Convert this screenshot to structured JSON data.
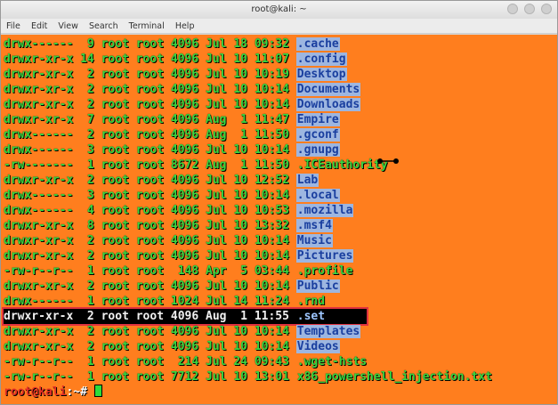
{
  "window": {
    "title": "root@kali: ~"
  },
  "menubar": {
    "items": [
      "File",
      "Edit",
      "View",
      "Search",
      "Terminal",
      "Help"
    ]
  },
  "listing": [
    {
      "perms": "drwx------",
      "links": "9",
      "owner": "root",
      "group": "root",
      "size": "4096",
      "month": "Jul",
      "day": "18",
      "time": "09:32",
      "name": ".cache",
      "kind": "dir"
    },
    {
      "perms": "drwxr-xr-x",
      "links": "14",
      "owner": "root",
      "group": "root",
      "size": "4096",
      "month": "Jul",
      "day": "10",
      "time": "11:07",
      "name": ".config",
      "kind": "dir"
    },
    {
      "perms": "drwxr-xr-x",
      "links": "2",
      "owner": "root",
      "group": "root",
      "size": "4096",
      "month": "Jul",
      "day": "10",
      "time": "10:19",
      "name": "Desktop",
      "kind": "dir"
    },
    {
      "perms": "drwxr-xr-x",
      "links": "2",
      "owner": "root",
      "group": "root",
      "size": "4096",
      "month": "Jul",
      "day": "10",
      "time": "10:14",
      "name": "Documents",
      "kind": "dir"
    },
    {
      "perms": "drwxr-xr-x",
      "links": "2",
      "owner": "root",
      "group": "root",
      "size": "4096",
      "month": "Jul",
      "day": "10",
      "time": "10:14",
      "name": "Downloads",
      "kind": "dir"
    },
    {
      "perms": "drwxr-xr-x",
      "links": "7",
      "owner": "root",
      "group": "root",
      "size": "4096",
      "month": "Aug",
      "day": "1",
      "time": "11:47",
      "name": "Empire",
      "kind": "dir"
    },
    {
      "perms": "drwx------",
      "links": "2",
      "owner": "root",
      "group": "root",
      "size": "4096",
      "month": "Aug",
      "day": "1",
      "time": "11:50",
      "name": ".gconf",
      "kind": "dir"
    },
    {
      "perms": "drwx------",
      "links": "3",
      "owner": "root",
      "group": "root",
      "size": "4096",
      "month": "Jul",
      "day": "10",
      "time": "10:14",
      "name": ".gnupg",
      "kind": "dir"
    },
    {
      "perms": "-rw-------",
      "links": "1",
      "owner": "root",
      "group": "root",
      "size": "8672",
      "month": "Aug",
      "day": "1",
      "time": "11:50",
      "name": ".ICEauthority",
      "kind": "file"
    },
    {
      "perms": "drwxr-xr-x",
      "links": "2",
      "owner": "root",
      "group": "root",
      "size": "4096",
      "month": "Jul",
      "day": "10",
      "time": "12:52",
      "name": "Lab",
      "kind": "dir"
    },
    {
      "perms": "drwx------",
      "links": "3",
      "owner": "root",
      "group": "root",
      "size": "4096",
      "month": "Jul",
      "day": "10",
      "time": "10:14",
      "name": ".local",
      "kind": "dir"
    },
    {
      "perms": "drwx------",
      "links": "4",
      "owner": "root",
      "group": "root",
      "size": "4096",
      "month": "Jul",
      "day": "10",
      "time": "10:53",
      "name": ".mozilla",
      "kind": "dir"
    },
    {
      "perms": "drwxr-xr-x",
      "links": "8",
      "owner": "root",
      "group": "root",
      "size": "4096",
      "month": "Jul",
      "day": "10",
      "time": "13:32",
      "name": ".msf4",
      "kind": "dir"
    },
    {
      "perms": "drwxr-xr-x",
      "links": "2",
      "owner": "root",
      "group": "root",
      "size": "4096",
      "month": "Jul",
      "day": "10",
      "time": "10:14",
      "name": "Music",
      "kind": "dir"
    },
    {
      "perms": "drwxr-xr-x",
      "links": "2",
      "owner": "root",
      "group": "root",
      "size": "4096",
      "month": "Jul",
      "day": "10",
      "time": "10:14",
      "name": "Pictures",
      "kind": "dir"
    },
    {
      "perms": "-rw-r--r--",
      "links": "1",
      "owner": "root",
      "group": "root",
      "size": "148",
      "month": "Apr",
      "day": "5",
      "time": "03:44",
      "name": ".profile",
      "kind": "file"
    },
    {
      "perms": "drwxr-xr-x",
      "links": "2",
      "owner": "root",
      "group": "root",
      "size": "4096",
      "month": "Jul",
      "day": "10",
      "time": "10:14",
      "name": "Public",
      "kind": "dir"
    },
    {
      "perms": "drwx------",
      "links": "1",
      "owner": "root",
      "group": "root",
      "size": "1024",
      "month": "Jul",
      "day": "14",
      "time": "11:24",
      "name": ".rnd",
      "kind": "file"
    },
    {
      "perms": "drwxr-xr-x",
      "links": "2",
      "owner": "root",
      "group": "root",
      "size": "4096",
      "month": "Aug",
      "day": "1",
      "time": "11:55",
      "name": ".set",
      "kind": "dir",
      "selected": true
    },
    {
      "perms": "drwxr-xr-x",
      "links": "2",
      "owner": "root",
      "group": "root",
      "size": "4096",
      "month": "Jul",
      "day": "10",
      "time": "10:14",
      "name": "Templates",
      "kind": "dir"
    },
    {
      "perms": "drwxr-xr-x",
      "links": "2",
      "owner": "root",
      "group": "root",
      "size": "4096",
      "month": "Jul",
      "day": "10",
      "time": "10:14",
      "name": "Videos",
      "kind": "dir"
    },
    {
      "perms": "-rw-r--r--",
      "links": "1",
      "owner": "root",
      "group": "root",
      "size": "214",
      "month": "Jul",
      "day": "24",
      "time": "09:43",
      "name": ".wget-hsts",
      "kind": "file"
    },
    {
      "perms": "-rw-r--r--",
      "links": "1",
      "owner": "root",
      "group": "root",
      "size": "7712",
      "month": "Jul",
      "day": "10",
      "time": "13:01",
      "name": "x86_powershell_injection.txt",
      "kind": "file"
    }
  ],
  "prompt": {
    "user": "root@kali",
    "rest": ":~# "
  },
  "colors": {
    "terminal_bg": "#ff7e1e",
    "text_green": "#38d640",
    "dir_highlight": "#9db6e0",
    "selection_border": "#e0323e"
  }
}
